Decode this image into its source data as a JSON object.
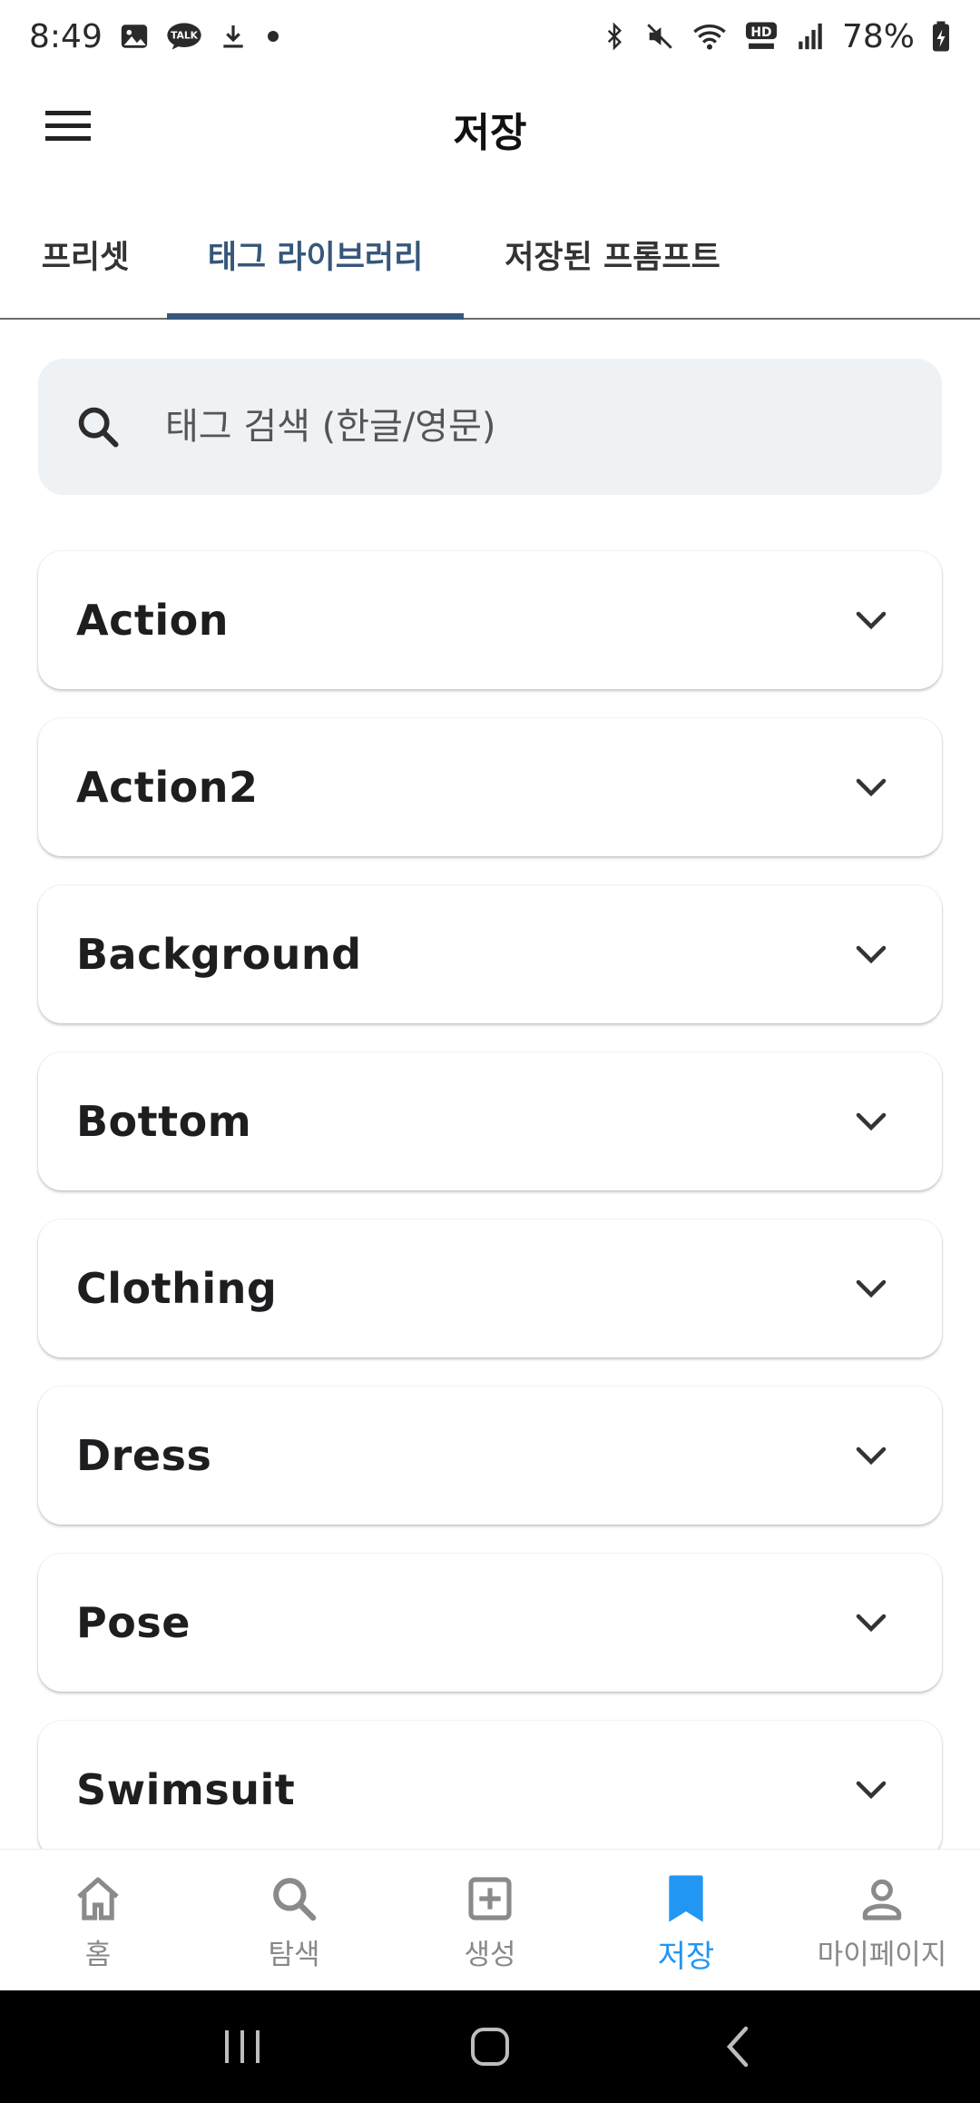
{
  "status_bar": {
    "time": "8:49",
    "battery": "78%",
    "left_icons": [
      "gallery-icon",
      "kakaotalk-icon",
      "download-icon",
      "dot-icon"
    ],
    "right_icons": [
      "bluetooth-icon",
      "mute-icon",
      "wifi-icon",
      "hd-voice-icon",
      "signal-icon",
      "battery-icon"
    ],
    "talk_badge": "TALK",
    "hd_badge": "HD"
  },
  "app_bar": {
    "title": "저장",
    "menu_icon": "hamburger-menu-icon"
  },
  "tabs": [
    {
      "label": "프리셋",
      "active": false
    },
    {
      "label": "태그 라이브러리",
      "active": true
    },
    {
      "label": "저장된 프롬프트",
      "active": false
    }
  ],
  "search": {
    "placeholder": "태그 검색 (한글/영문)",
    "value": ""
  },
  "categories": [
    {
      "label": "Action"
    },
    {
      "label": "Action2"
    },
    {
      "label": "Background"
    },
    {
      "label": "Bottom"
    },
    {
      "label": "Clothing"
    },
    {
      "label": "Dress"
    },
    {
      "label": "Pose"
    },
    {
      "label": "Swimsuit"
    }
  ],
  "bottom_nav": [
    {
      "label": "홈",
      "icon": "home-icon",
      "active": false
    },
    {
      "label": "탐색",
      "icon": "search-icon",
      "active": false
    },
    {
      "label": "생성",
      "icon": "add-box-icon",
      "active": false
    },
    {
      "label": "저장",
      "icon": "bookmark-icon",
      "active": true
    },
    {
      "label": "마이페이지",
      "icon": "person-icon",
      "active": false
    }
  ],
  "colors": {
    "accent_tab": "#37577b",
    "accent_nav": "#2196f3",
    "search_bg": "#eff2f5"
  }
}
